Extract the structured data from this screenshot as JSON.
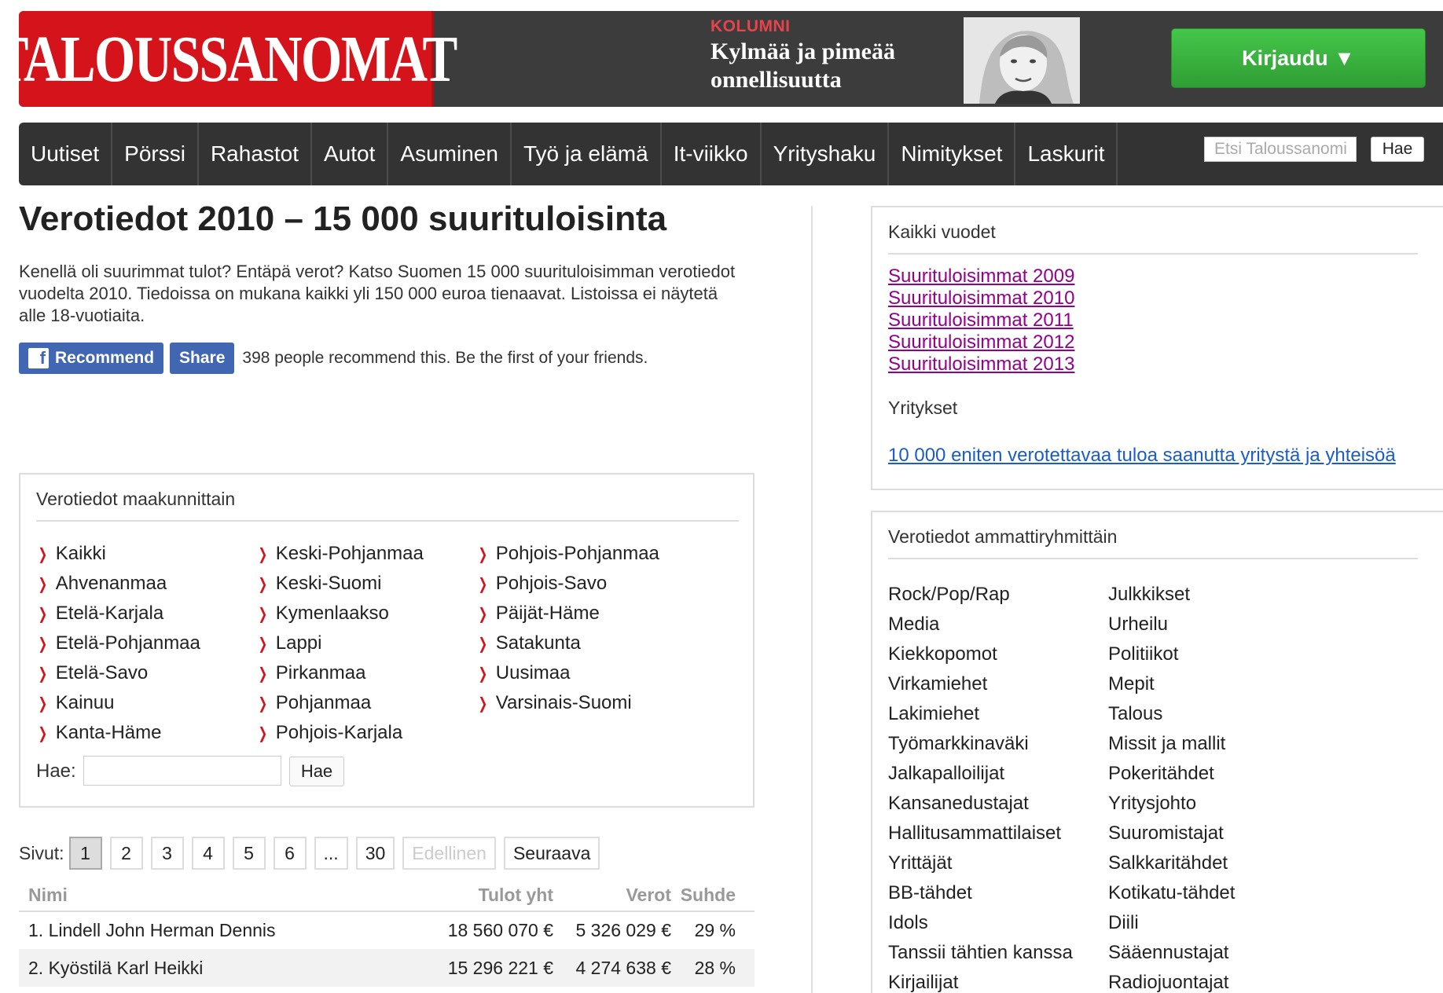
{
  "header": {
    "logo": "TALOUSSANOMAT",
    "column_label": "KOLUMNI",
    "column_title": "Kylmää ja pimeää onnellisuutta",
    "login_label": "Kirjaudu ▼"
  },
  "nav": {
    "items": [
      "Uutiset",
      "Pörssi",
      "Rahastot",
      "Autot",
      "Asuminen",
      "Työ ja elämä",
      "It-viikko",
      "Yrityshaku",
      "Nimitykset",
      "Laskurit"
    ],
    "search_placeholder": "Etsi Taloussanomista",
    "search_button": "Hae"
  },
  "page": {
    "title": "Verotiedot 2010 – 15 000 suurituloisinta",
    "intro": "Kenellä oli suurimmat tulot? Entäpä verot? Katso Suomen 15 000 suurituloisimman verotiedot vuodelta 2010. Tiedoissa on mukana kaikki yli 150 000 euroa tienaavat. Listoissa ei näytetä alle 18-vuotiaita."
  },
  "facebook": {
    "recommend": "Recommend",
    "share": "Share",
    "text": "398 people recommend this. Be the first of your friends."
  },
  "regions": {
    "heading": "Verotiedot maakunnittain",
    "col1": [
      "Kaikki",
      "Ahvenanmaa",
      "Etelä-Karjala",
      "Etelä-Pohjanmaa",
      "Etelä-Savo",
      "Kainuu",
      "Kanta-Häme"
    ],
    "col2": [
      "Keski-Pohjanmaa",
      "Keski-Suomi",
      "Kymenlaakso",
      "Lappi",
      "Pirkanmaa",
      "Pohjanmaa",
      "Pohjois-Karjala"
    ],
    "col3": [
      "Pohjois-Pohjanmaa",
      "Pohjois-Savo",
      "Päijät-Häme",
      "Satakunta",
      "Uusimaa",
      "Varsinais-Suomi"
    ],
    "search_label": "Hae:",
    "search_button": "Hae"
  },
  "pager": {
    "label": "Sivut:",
    "pages": [
      "1",
      "2",
      "3",
      "4",
      "5",
      "6",
      "...",
      "30"
    ],
    "current": "1",
    "prev": "Edellinen",
    "next": "Seuraava"
  },
  "table": {
    "headers": [
      "Nimi",
      "Tulot yht",
      "Verot",
      "Suhde"
    ],
    "rows": [
      [
        "1. Lindell John Herman Dennis",
        "18 560 070 €",
        "5 326 029 €",
        "29 %"
      ],
      [
        "2. Kyöstilä Karl Heikki",
        "15 296 221 €",
        "4 274 638 €",
        "28 %"
      ]
    ]
  },
  "sidebar": {
    "years_heading": "Kaikki vuodet",
    "years": [
      "Suurituloisimmat 2009",
      "Suurituloisimmat 2010",
      "Suurituloisimmat 2011",
      "Suurituloisimmat 2012",
      "Suurituloisimmat 2013"
    ],
    "companies_heading": "Yritykset",
    "companies_link": "10 000 eniten verotettavaa tuloa saanutta yritystä ja yhteisöä",
    "professions_heading": "Verotiedot ammattiryhmittäin",
    "prof_col1": [
      "Rock/Pop/Rap",
      "Media",
      "Kiekkopomot",
      "Virkamiehet",
      "Lakimiehet",
      "Työmarkkinaväki",
      "Jalkapalloilijat",
      "Kansanedustajat",
      "Hallitusammattilaiset",
      "Yrittäjät",
      "BB-tähdet",
      "Idols",
      "Tanssii tähtien kanssa",
      "Kirjailijat"
    ],
    "prof_col2": [
      "Julkkikset",
      "Urheilu",
      "Politiikot",
      "Mepit",
      "Talous",
      "Missit ja mallit",
      "Pokeritähdet",
      "Yritysjohto",
      "Suuromistajat",
      "Salkkaritähdet",
      "Kotikatu-tähdet",
      "Diili",
      "Sääennustajat",
      "Radiojuontajat"
    ]
  },
  "colors": {
    "brand_red": "#d4141a",
    "nav_bg": "#333333",
    "login_green": "#3bb540",
    "visited_link": "#93008c",
    "link_blue": "#1a5dc8",
    "facebook_blue": "#4267b2"
  }
}
